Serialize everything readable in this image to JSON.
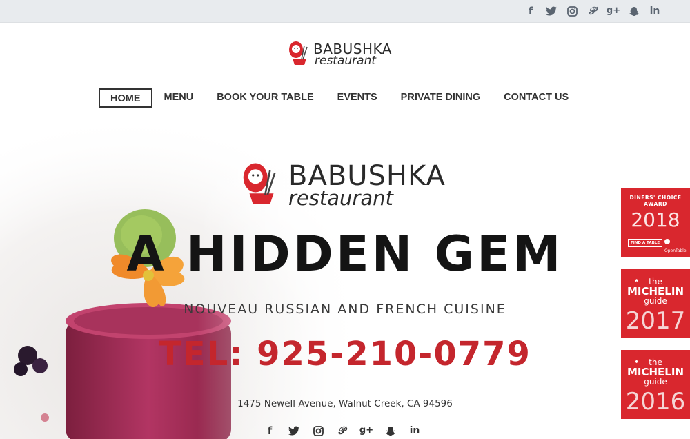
{
  "colors": {
    "brand_red": "#c4262d",
    "badge_red": "#d9272e",
    "topbar": "#e8ebee",
    "text_dark": "#141414"
  },
  "top_social": [
    "facebook-icon",
    "twitter-icon",
    "instagram-icon",
    "pinterest-icon",
    "google-plus-icon",
    "snapchat-icon",
    "linkedin-icon"
  ],
  "logo": {
    "line1": "BABUSHKA",
    "line2": "restaurant"
  },
  "nav": {
    "items": [
      {
        "label": "HOME",
        "active": true
      },
      {
        "label": "MENU"
      },
      {
        "label": "BOOK YOUR TABLE"
      },
      {
        "label": "EVENTS"
      },
      {
        "label": "PRIVATE DINING"
      },
      {
        "label": "CONTACT US"
      }
    ]
  },
  "hero": {
    "logo_line1": "BABUSHKA",
    "logo_line2": "restaurant",
    "headline": "A HIDDEN GEM",
    "subhead": "NOUVEAU RUSSIAN AND FRENCH CUISINE",
    "phone": "TEL: 925-210-0779",
    "address": "1475 Newell Avenue, Walnut Creek, CA 94596"
  },
  "badges": {
    "diners_choice": {
      "line1": "DINERS' CHOICE",
      "line2": "AWARD",
      "year": "2018",
      "find_table": "FIND A TABLE",
      "opentable": "OpenTable"
    },
    "michelin_2017": {
      "the": "the",
      "brand": "MICHELIN",
      "guide": "guide",
      "year": "2017"
    },
    "michelin_2016": {
      "the": "the",
      "brand": "MICHELIN",
      "guide": "guide",
      "year": "2016"
    }
  }
}
